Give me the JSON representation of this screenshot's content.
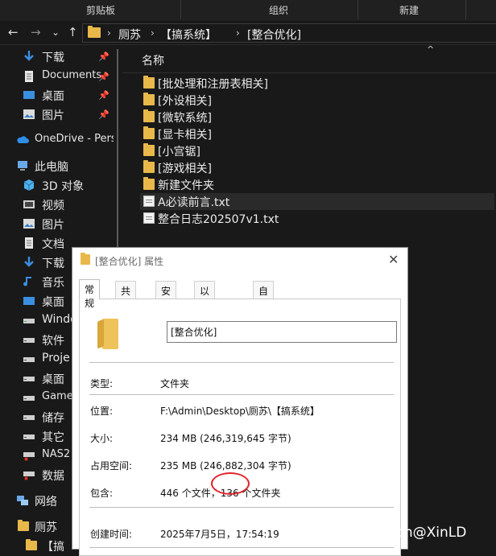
{
  "ribbon": {
    "groups": [
      "剪贴板",
      "组织",
      "新建"
    ]
  },
  "navigation": {
    "back": "←",
    "forward": "→",
    "recent": "⌄",
    "up": "↑"
  },
  "address": {
    "crumbs": [
      "厕苏",
      "【搞系统】",
      "[整合优化]"
    ]
  },
  "nav_pane": {
    "items": [
      {
        "label": "下载",
        "icon": "download-icon",
        "pinned": true
      },
      {
        "label": "Documents",
        "icon": "document-icon",
        "pinned": true
      },
      {
        "label": "桌面",
        "icon": "desktop-icon",
        "pinned": true
      },
      {
        "label": "图片",
        "icon": "picture-icon",
        "pinned": true
      },
      {
        "label": "OneDrive - Pers",
        "icon": "cloud-icon",
        "pinned": false
      },
      {
        "label": "此电脑",
        "icon": "computer-icon",
        "pinned": false
      },
      {
        "label": "3D 对象",
        "icon": "cube-icon",
        "pinned": false
      },
      {
        "label": "视频",
        "icon": "video-icon",
        "pinned": false
      },
      {
        "label": "图片",
        "icon": "picture-icon",
        "pinned": false
      },
      {
        "label": "文档",
        "icon": "document-icon",
        "pinned": false
      },
      {
        "label": "下载",
        "icon": "download-icon",
        "pinned": false
      },
      {
        "label": "音乐",
        "icon": "music-icon",
        "pinned": false
      },
      {
        "label": "桌面",
        "icon": "desktop-icon",
        "pinned": false
      },
      {
        "label": "Windo",
        "icon": "drive-icon",
        "pinned": false
      },
      {
        "label": "软件",
        "icon": "drive-icon",
        "pinned": false
      },
      {
        "label": "Proje",
        "icon": "drive-icon",
        "pinned": false
      },
      {
        "label": "桌面",
        "icon": "drive-icon",
        "pinned": false
      },
      {
        "label": "Game",
        "icon": "drive-icon",
        "pinned": false
      },
      {
        "label": "储存",
        "icon": "drive-icon",
        "pinned": false
      },
      {
        "label": "其它",
        "icon": "drive-icon",
        "pinned": false
      },
      {
        "label": "NAS2",
        "icon": "network-drive-icon",
        "pinned": false
      },
      {
        "label": "数据",
        "icon": "network-drive-icon",
        "pinned": false
      },
      {
        "label": "网络",
        "icon": "network-icon",
        "pinned": false
      },
      {
        "label": "厕苏",
        "icon": "folder-icon",
        "pinned": false
      },
      {
        "label": "【搞",
        "icon": "folder-icon",
        "pinned": false
      }
    ]
  },
  "file_list": {
    "column_name": "名称",
    "sort_indicator": "^",
    "rows": [
      {
        "name": "[批处理和注册表相关]",
        "type": "folder",
        "selected": false
      },
      {
        "name": "[外设相关]",
        "type": "folder",
        "selected": false
      },
      {
        "name": "[微软系统]",
        "type": "folder",
        "selected": false
      },
      {
        "name": "[显卡相关]",
        "type": "folder",
        "selected": false
      },
      {
        "name": "[小宫锯]",
        "type": "folder",
        "selected": false
      },
      {
        "name": "[游戏相关]",
        "type": "folder",
        "selected": false
      },
      {
        "name": "新建文件夹",
        "type": "folder",
        "selected": false
      },
      {
        "name": "A必读前言.txt",
        "type": "text",
        "selected": true
      },
      {
        "name": "整合日志202507v1.txt",
        "type": "text",
        "selected": false
      }
    ]
  },
  "dialog": {
    "title": "[整合优化] 属性",
    "close": "✕",
    "tabs": [
      "常规",
      "共享",
      "安全",
      "以前的版本",
      "自定义"
    ],
    "active_tab": 0,
    "folder_name": "[整合优化]",
    "props": [
      {
        "key": "类型:",
        "value": "文件夹"
      },
      {
        "key": "位置:",
        "value": "F:\\Admin\\Desktop\\厕苏\\【搞系统】"
      },
      {
        "key": "大小:",
        "value": "234 MB (246,319,645 字节)"
      },
      {
        "key": "占用空间:",
        "value": "235 MB (246,882,304 字节)"
      },
      {
        "key": "包含:",
        "value": "446 个文件，136 个文件夹"
      },
      {
        "key": "创建时间:",
        "value": "2025年7月5日，17:54:19"
      }
    ],
    "highlight_color": "#e3232b"
  },
  "watermark": "sns.oddba.cn@XinLD",
  "colors": {
    "background": "#191919",
    "folder": "#e8b84a",
    "dialog_bg": "#ffffff"
  }
}
